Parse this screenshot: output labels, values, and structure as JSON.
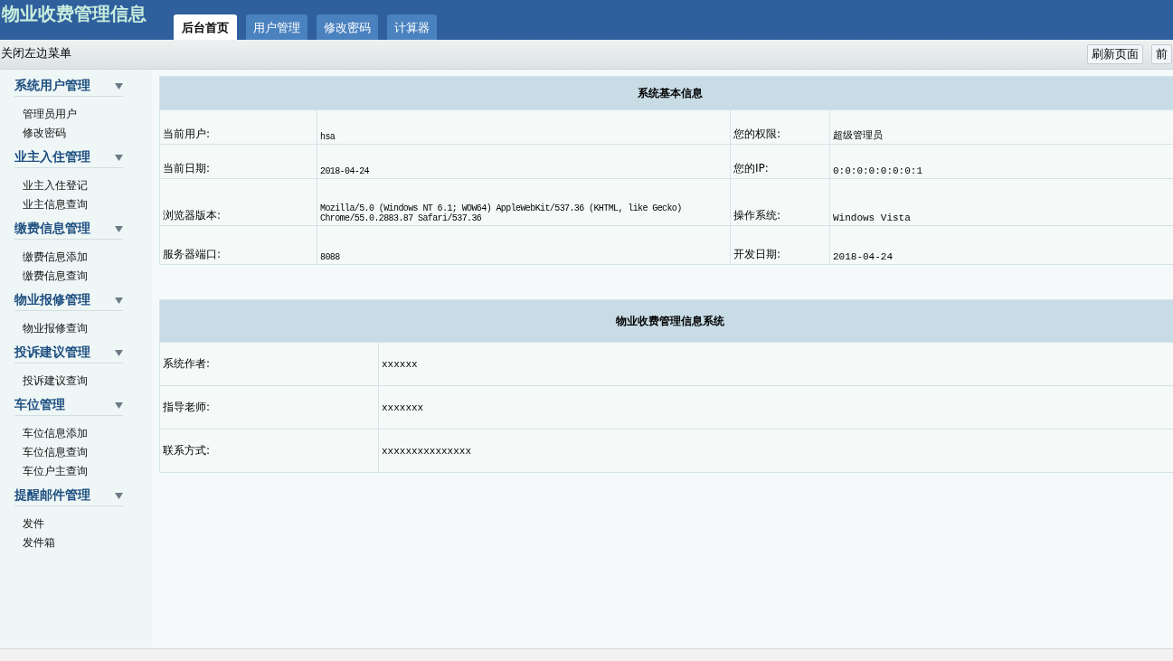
{
  "header": {
    "title": "物业收费管理信息",
    "tabs": [
      {
        "label": "后台首页",
        "selected": true
      },
      {
        "label": "用户管理",
        "selected": false
      },
      {
        "label": "修改密码",
        "selected": false
      },
      {
        "label": "计算器",
        "selected": false
      }
    ]
  },
  "toolbar": {
    "toggle": "关闭左边菜单",
    "buttons": [
      "刷新页面",
      "前"
    ]
  },
  "sidebar": {
    "groups": [
      {
        "title": "系统用户管理",
        "items": [
          "管理员用户",
          "修改密码"
        ]
      },
      {
        "title": "业主入住管理",
        "items": [
          "业主入住登记",
          "业主信息查询"
        ]
      },
      {
        "title": "缴费信息管理",
        "items": [
          "缴费信息添加",
          "缴费信息查询"
        ]
      },
      {
        "title": "物业报修管理",
        "items": [
          "物业报修查询"
        ]
      },
      {
        "title": "投诉建议管理",
        "items": [
          "投诉建议查询"
        ]
      },
      {
        "title": "车位管理",
        "items": [
          "车位信息添加",
          "车位信息查询",
          "车位户主查询"
        ]
      },
      {
        "title": "提醒邮件管理",
        "items": [
          "发件",
          "发件箱"
        ]
      }
    ]
  },
  "system_info": {
    "title": "系统基本信息",
    "rows": [
      {
        "label": "当前用户:",
        "value": "hsa",
        "label2": "您的权限:",
        "value2": "超级管理员"
      },
      {
        "label": "当前日期:",
        "value": "2018-04-24",
        "label2": "您的IP:",
        "value2": "0:0:0:0:0:0:0:1"
      },
      {
        "label": "浏览器版本:",
        "value": "Mozilla/5.0 (Windows NT 6.1; WOW64) AppleWebKit/537.36 (KHTML, like Gecko) Chrome/55.0.2883.87 Safari/537.36",
        "label2": "操作系统:",
        "value2": "Windows Vista"
      },
      {
        "label": "服务器端口:",
        "value": "8088",
        "label2": "开发日期:",
        "value2": "2018-04-24"
      }
    ]
  },
  "about": {
    "title": "物业收费管理信息系统",
    "rows": [
      {
        "label": "系统作者:",
        "value": "xxxxxx"
      },
      {
        "label": "指导老师:",
        "value": "xxxxxxx"
      },
      {
        "label": "联系方式:",
        "value": "xxxxxxxxxxxxxxx"
      }
    ]
  }
}
